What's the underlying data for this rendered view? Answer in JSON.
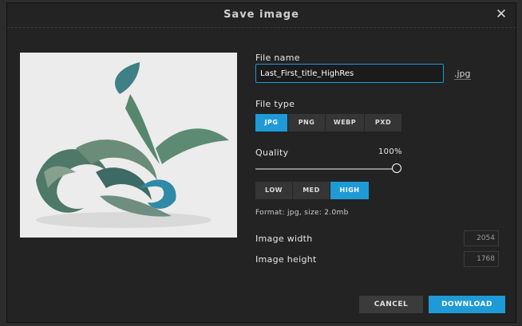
{
  "dialog": {
    "title": "Save image",
    "close_icon": "close-icon"
  },
  "file_name": {
    "label": "File name",
    "value": "Last_First_title_HighRes",
    "extension": ".jpg"
  },
  "file_type": {
    "label": "File type",
    "options": [
      "JPG",
      "PNG",
      "WEBP",
      "PXD"
    ],
    "selected": "JPG"
  },
  "quality": {
    "label": "Quality",
    "value_text": "100%",
    "level": 1.0,
    "presets": [
      "LOW",
      "MED",
      "HIGH"
    ],
    "selected_preset": "HIGH"
  },
  "format_info": "Format: jpg, size: 2.0mb",
  "image_width": {
    "label": "Image width",
    "value": "2054"
  },
  "image_height": {
    "label": "Image height",
    "value": "1768"
  },
  "footer": {
    "cancel_label": "CANCEL",
    "download_label": "DOWNLOAD"
  },
  "colors": {
    "accent": "#1e9ad6",
    "background": "#232323"
  }
}
